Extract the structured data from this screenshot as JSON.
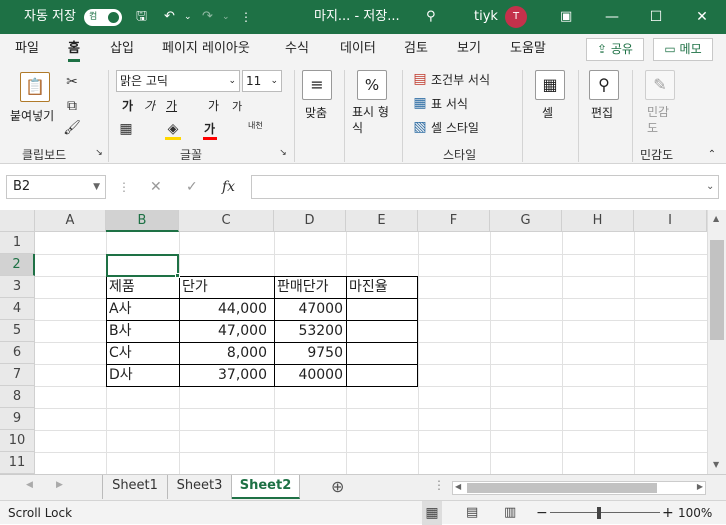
{
  "titlebar": {
    "autosave_label": "자동 저장",
    "autosave_state": "컴",
    "doc_title": "마지... - 저장...",
    "user_name": "tiyk",
    "avatar_initial": "T",
    "minimize": "—",
    "maximize": "☐",
    "close": "✕",
    "accent_color": "#1e7145"
  },
  "menu": {
    "tabs": [
      "파일",
      "홈",
      "삽입",
      "페이지 레이아웃",
      "수식",
      "데이터",
      "검토",
      "보기",
      "도움말"
    ],
    "active_tab": "홈",
    "share_label": "공유",
    "memo_label": "메모"
  },
  "ribbon": {
    "clipboard": {
      "paste": "붙여넣기",
      "group": "클립보드"
    },
    "font": {
      "name": "맑은 고딕",
      "size": "11",
      "bold": "가",
      "italic": "가",
      "underline": "가",
      "grow": "가",
      "shrink": "가",
      "fill_color": "#ffd700",
      "font_color": "#ff0000",
      "phonetic": "내천",
      "group": "글꼴"
    },
    "alignment": {
      "label": "맞춤"
    },
    "number": {
      "label": "표시 형식",
      "symbol": "%"
    },
    "styles": {
      "conditional": "조건부 서식",
      "table": "표 서식",
      "cell": "셀 스타일",
      "group": "스타일"
    },
    "cells": {
      "label": "셀"
    },
    "editing": {
      "label": "편집"
    },
    "sensitivity": {
      "label": "민감도",
      "group": "민감도"
    }
  },
  "formula_bar": {
    "name_box": "B2",
    "fx": "fx",
    "formula": ""
  },
  "columns": [
    "A",
    "B",
    "C",
    "D",
    "E",
    "F",
    "G",
    "H",
    "I"
  ],
  "rows": [
    "1",
    "2",
    "3",
    "4",
    "5",
    "6",
    "7",
    "8",
    "9",
    "10",
    "11"
  ],
  "selected_cell": "B2",
  "table": {
    "headers": [
      "제품",
      "단가",
      "판매단가",
      "마진율"
    ],
    "rows": [
      {
        "product": "A사",
        "price": "44,000",
        "sale": "47000",
        "margin": ""
      },
      {
        "product": "B사",
        "price": "47,000",
        "sale": "53200",
        "margin": ""
      },
      {
        "product": "C사",
        "price": "8,000",
        "sale": "9750",
        "margin": ""
      },
      {
        "product": "D사",
        "price": "37,000",
        "sale": "40000",
        "margin": ""
      }
    ]
  },
  "sheets": [
    "Sheet1",
    "Sheet3",
    "Sheet2"
  ],
  "active_sheet": "Sheet2",
  "status": {
    "left": "Scroll Lock",
    "zoom": "100%"
  }
}
